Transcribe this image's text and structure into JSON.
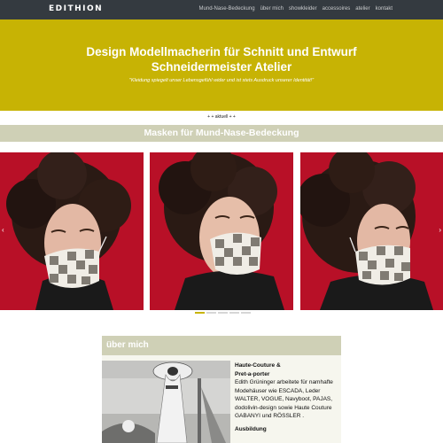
{
  "navbar": {
    "brand": "EDITHION",
    "links": [
      "Mund-Nase-Bedeckung",
      "über mich",
      "showkleider",
      "accessoires",
      "atelier",
      "kontakt"
    ]
  },
  "hero": {
    "title_line1": "Design Modellmacherin für Schnitt und Entwurf",
    "title_line2": "Schneidermeister Atelier",
    "quote": "\"Kleidung spiegelt unser Lebensgefühl wider und ist stets Ausdruck unserer Identität!\""
  },
  "aktuell_link": "+ + aktuell + +",
  "masks_section": {
    "title": "Masken für Mund-Nase-Bedeckung"
  },
  "carousel": {
    "prev_icon": "‹",
    "next_icon": "›",
    "active_index": 0,
    "indicator_count": 5
  },
  "about": {
    "title": "über mich",
    "heading1": "Haute-Couture &",
    "heading2": "Pret-a-porter",
    "text": "Edith Grüninger arbeitete für namhafte Modehäuser wie ESCADA, Leder WALTER, VOGUE, Navyboot, PAJAS, dodolivin-design sowie Haute Couture GABANYI und RÖSSLER .",
    "heading3": "Ausbildung"
  },
  "colors": {
    "navbar": "#343a40",
    "accent": "#c7b304",
    "section": "#cfd0b6",
    "slide_bg": "#b81027"
  }
}
